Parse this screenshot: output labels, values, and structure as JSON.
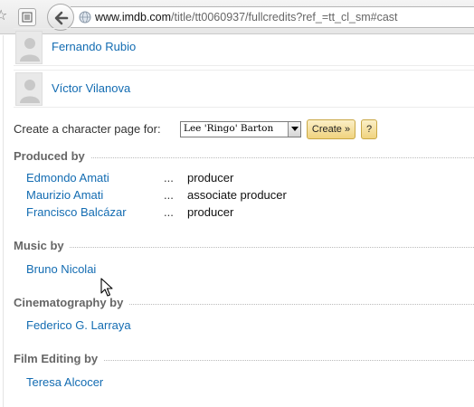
{
  "browser": {
    "url_domain": "www.imdb.com",
    "url_rest": "/title/tt0060937/fullcredits?ref_=tt_cl_sm#cast"
  },
  "cast_rows": [
    {
      "name": "Fernando Rubio"
    },
    {
      "name": "Víctor Vilanova"
    }
  ],
  "character_page": {
    "label": "Create a character page for:",
    "selected": "Lee 'Ringo' Barton",
    "create_label": "Create »",
    "help_label": "?"
  },
  "sections": [
    {
      "title": "Produced by",
      "credits": [
        {
          "name": "Edmondo Amati",
          "dots": "...",
          "role": "producer"
        },
        {
          "name": "Maurizio Amati",
          "dots": "...",
          "role": "associate producer"
        },
        {
          "name": "Francisco Balcázar",
          "dots": "...",
          "role": "producer"
        }
      ]
    },
    {
      "title": "Music by",
      "credits": [
        {
          "name": "Bruno Nicolai"
        }
      ]
    },
    {
      "title": "Cinematography by",
      "credits": [
        {
          "name": "Federico G. Larraya"
        }
      ]
    },
    {
      "title": "Film Editing by",
      "credits": [
        {
          "name": "Teresa Alcocer"
        }
      ]
    }
  ],
  "icons": {
    "bookmark": "star-icon",
    "reader": "reader-view-icon",
    "back": "back-arrow-icon",
    "site": "globe-icon",
    "avatar": "person-placeholder-icon",
    "cursor": "mouse-cursor-icon"
  },
  "colors": {
    "link": "#136cb2",
    "button": "#f0d37e",
    "section_title": "#666666"
  }
}
